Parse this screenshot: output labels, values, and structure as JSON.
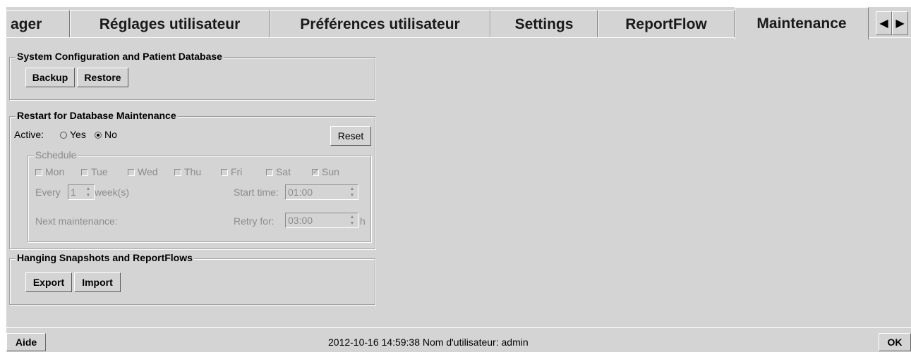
{
  "tabs": [
    {
      "label": "ager",
      "active": false
    },
    {
      "label": "Réglages utilisateur",
      "active": false
    },
    {
      "label": "Préférences utilisateur",
      "active": false
    },
    {
      "label": "Settings",
      "active": false
    },
    {
      "label": "ReportFlow",
      "active": false
    },
    {
      "label": "Maintenance",
      "active": true
    }
  ],
  "tab_scroll": {
    "left": "◀",
    "right": "▶"
  },
  "system_config": {
    "title": "System Configuration and Patient Database",
    "backup_label": "Backup",
    "restore_label": "Restore"
  },
  "restart": {
    "title": "Restart for Database Maintenance",
    "active_label": "Active:",
    "yes_label": "Yes",
    "no_label": "No",
    "selected": "No",
    "reset_label": "Reset",
    "schedule": {
      "title": "Schedule",
      "days": [
        {
          "label": "Mon",
          "checked": false
        },
        {
          "label": "Tue",
          "checked": false
        },
        {
          "label": "Wed",
          "checked": false
        },
        {
          "label": "Thu",
          "checked": false
        },
        {
          "label": "Fri",
          "checked": false
        },
        {
          "label": "Sat",
          "checked": false
        },
        {
          "label": "Sun",
          "checked": true
        }
      ],
      "every_label": "Every",
      "every_value": "1",
      "weeks_label": "week(s)",
      "start_time_label": "Start time:",
      "start_time_value": "01:00",
      "next_maintenance_label": "Next maintenance:",
      "retry_label": "Retry for:",
      "retry_value": "03:00",
      "retry_unit": "h"
    }
  },
  "hanging": {
    "title": "Hanging Snapshots and ReportFlows",
    "export_label": "Export",
    "import_label": "Import"
  },
  "statusbar": {
    "help_label": "Aide",
    "status_text": "2012-10-16  14:59:38  Nom d'utilisateur:  admin",
    "ok_label": "OK"
  }
}
